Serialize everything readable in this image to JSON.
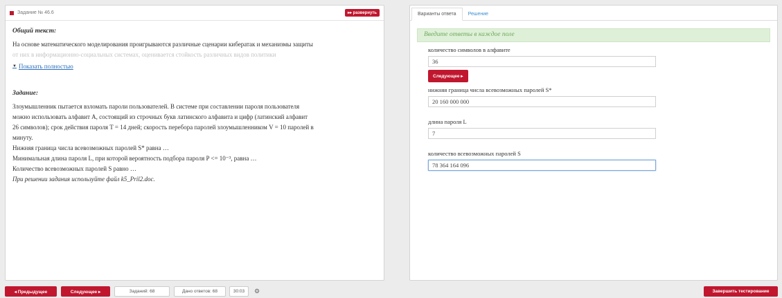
{
  "task_panel": {
    "task_label": "Задание № 46.6",
    "expand_label": "▸▸ развернуть",
    "general_text_title": "Общий текст:",
    "general_text_line1": "На основе математического моделирования проигрываются различные сценарии кибератак и механизмы защиты",
    "general_text_line2": "от них в информационно-социальных системах, оценивается стойкость различных видов политики",
    "show_all": "Показать полностью",
    "task_title": "Задание:",
    "task_lines": [
      "Злоумышленник пытается взломать пароли пользователей. В системе при составлении пароля пользователя",
      "можно использовать алфавит A, состоящий из строчных букв латинского алфавита и цифр (латинский алфавит",
      "26 символов); срок действия пароля T = 14 дней; скорость перебора паролей злоумышленником V = 10 паролей в",
      "минуту.",
      "Нижняя граница числа всевозможных паролей S* равна …",
      "Минимальная длина пароля L, при которой вероятность подбора пароля P <= 10⁻³, равна …",
      "Количество всевозможных паролей S равно …"
    ],
    "task_note": "При решении задания используйте файл k5_Pril2.doc."
  },
  "answer_panel": {
    "tabs": [
      "Варианты ответа",
      "Решение"
    ],
    "hint": "Введите ответы в каждое поле",
    "fields": [
      {
        "label": "количество символов в алфавите",
        "value": "36"
      },
      {
        "label": "нижняя граница числа всевозможных паролей S*",
        "value": "20 160 000 000"
      },
      {
        "label": "длина пароля L",
        "value": "7"
      },
      {
        "label": "количество всевозможных паролей S",
        "value": "78 364 164 096"
      }
    ],
    "next_label": "Следующее ▸"
  },
  "bottom_bar": {
    "prev_label": "◂ Предыдущее",
    "next_label": "Следующее ▸",
    "tasks_count": "Заданий: 68",
    "answers_count": "Дано ответов: 68",
    "timer": "30:03",
    "finish_label": "Завершить тестирование"
  },
  "colors": {
    "accent": "#c0172f",
    "hint_bg": "#dff0d8",
    "link": "#2a6ebb"
  }
}
